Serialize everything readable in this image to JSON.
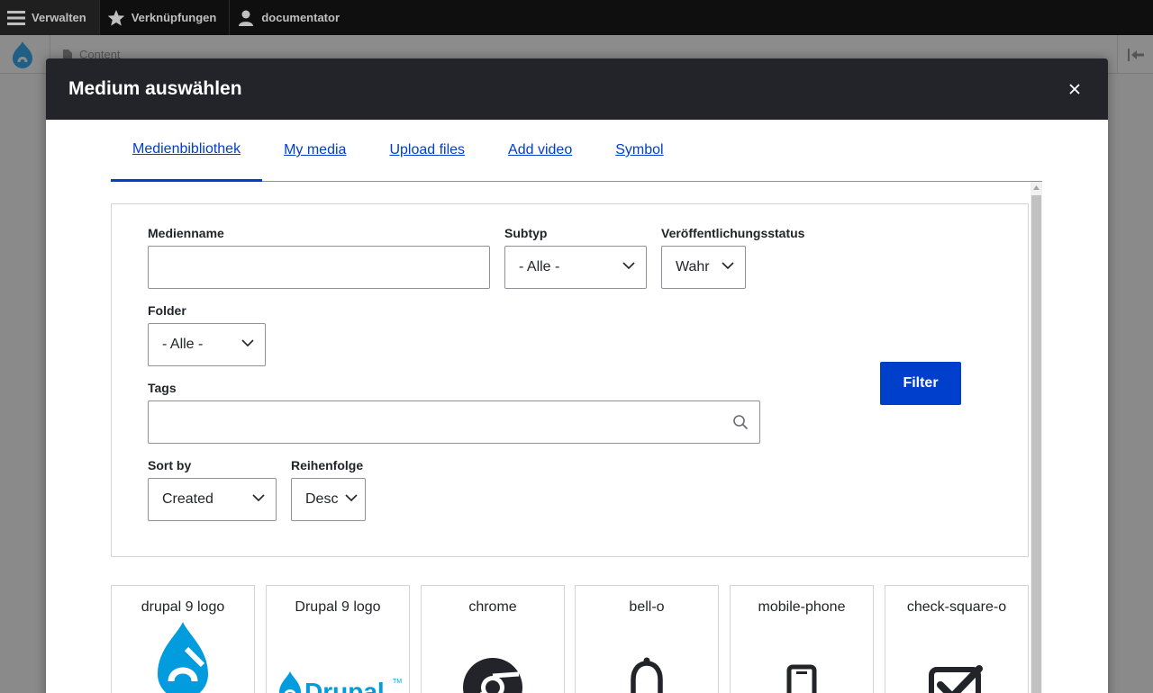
{
  "toolbar": {
    "manage_label": "Verwalten",
    "shortcuts_label": "Verknüpfungen",
    "user_label": "documentator"
  },
  "background": {
    "content_tab_label": "Content"
  },
  "modal": {
    "title": "Medium auswählen",
    "tabs": [
      {
        "label": "Medienbibliothek",
        "active": true
      },
      {
        "label": "My media",
        "active": false
      },
      {
        "label": "Upload files",
        "active": false
      },
      {
        "label": "Add video",
        "active": false
      },
      {
        "label": "Symbol",
        "active": false
      }
    ],
    "filters": {
      "media_name": {
        "label": "Medienname",
        "value": ""
      },
      "subtype": {
        "label": "Subtyp",
        "value": "- Alle -"
      },
      "status": {
        "label": "Veröffentlichungsstatus",
        "value": "Wahr"
      },
      "folder": {
        "label": "Folder",
        "value": "- Alle -"
      },
      "tags": {
        "label": "Tags",
        "value": ""
      },
      "sort_by": {
        "label": "Sort by",
        "value": "Created"
      },
      "order": {
        "label": "Reihenfolge",
        "value": "Desc"
      },
      "filter_button": "Filter"
    },
    "media_items": [
      {
        "title": "drupal 9 logo",
        "icon": "drupal-drop-logo"
      },
      {
        "title": "Drupal 9 logo",
        "icon": "drupal-wordmark-logo"
      },
      {
        "title": "chrome",
        "icon": "chrome-icon"
      },
      {
        "title": "bell-o",
        "icon": "bell-icon"
      },
      {
        "title": "mobile-phone",
        "icon": "mobile-phone-icon"
      },
      {
        "title": "check-square-o",
        "icon": "check-square-icon"
      }
    ]
  },
  "colors": {
    "toolbar_bg": "#0f0f0f",
    "modal_header_bg": "#232429",
    "accent": "#003ecc",
    "drupal_blue": "#009cde"
  }
}
